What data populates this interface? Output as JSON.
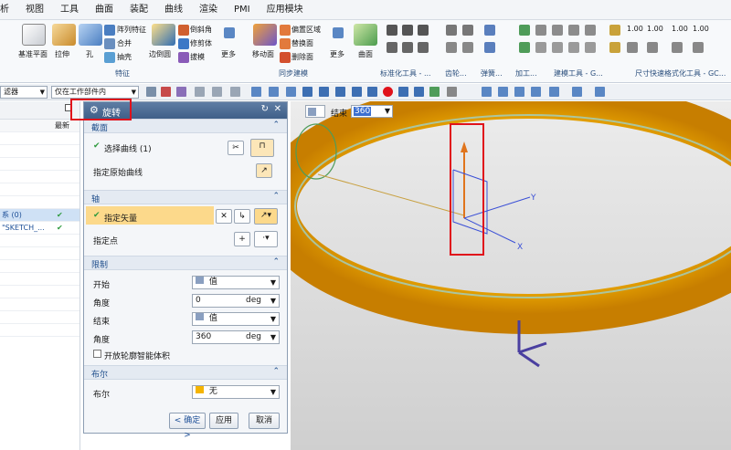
{
  "menu": [
    "析",
    "视图",
    "工具",
    "曲面",
    "装配",
    "曲线",
    "渲染",
    "PMI",
    "应用模块"
  ],
  "ribbon": {
    "datum_label": "基准平面",
    "extrude_label": "拉伸",
    "hole_label": "孔",
    "pattern_label": "阵列特征",
    "unite_label": "合并",
    "shell_label": "抽壳",
    "edge_blend_label": "边倒圆",
    "chamfer_label": "倒斜角",
    "trim_body_label": "修剪体",
    "draft_label": "拔模",
    "more1_label": "更多",
    "move_face_label": "移动面",
    "offset_region_label": "偏置区域",
    "replace_face_label": "替换面",
    "delete_face_label": "删除面",
    "more2_label": "更多",
    "surface_label": "曲面",
    "group_feature": "特征",
    "group_sync": "同步建模",
    "group_std": "标准化工具 - ...",
    "group_gear": "齿轮...",
    "group_spring": "弹簧...",
    "group_machining": "加工...",
    "group_build": "建模工具 - G...",
    "group_dim": "尺寸快速格式化工具 - GC...",
    "dims": [
      "1.00",
      "1.00",
      "1.00",
      "1.00"
    ]
  },
  "toolbar": {
    "filter_text": "滤器",
    "scope_text": "仅在工作部件内"
  },
  "nav": {
    "col_new": "最新",
    "row1": "系 (0)",
    "row2": "\"SKETCH_..."
  },
  "dialog": {
    "title": "旋转",
    "section_profile": "截面",
    "select_curve": "选择曲线 (1)",
    "specify_origin_curve": "指定原始曲线",
    "section_axis": "轴",
    "specify_vector": "指定矢量",
    "specify_point": "指定点",
    "section_limits": "限制",
    "start_label": "开始",
    "start_value": "值",
    "angle1_label": "角度",
    "angle1_value": "0",
    "unit": "deg",
    "end_label": "结束",
    "end_value": "值",
    "angle2_label": "角度",
    "angle2_value": "360",
    "open_profile_smart": "开放轮廓智能体积",
    "section_boolean": "布尔",
    "boolean_label": "布尔",
    "boolean_value": "无",
    "ok": "< 确定 >",
    "apply": "应用",
    "cancel": "取消"
  },
  "viewport": {
    "end_label": "结束",
    "end_value": "360",
    "axis_y": "Y",
    "axis_x": "X"
  },
  "colors": {
    "torus": "#f5b400",
    "highlight": "#e0121b",
    "title_bar": "#4a6a93"
  }
}
